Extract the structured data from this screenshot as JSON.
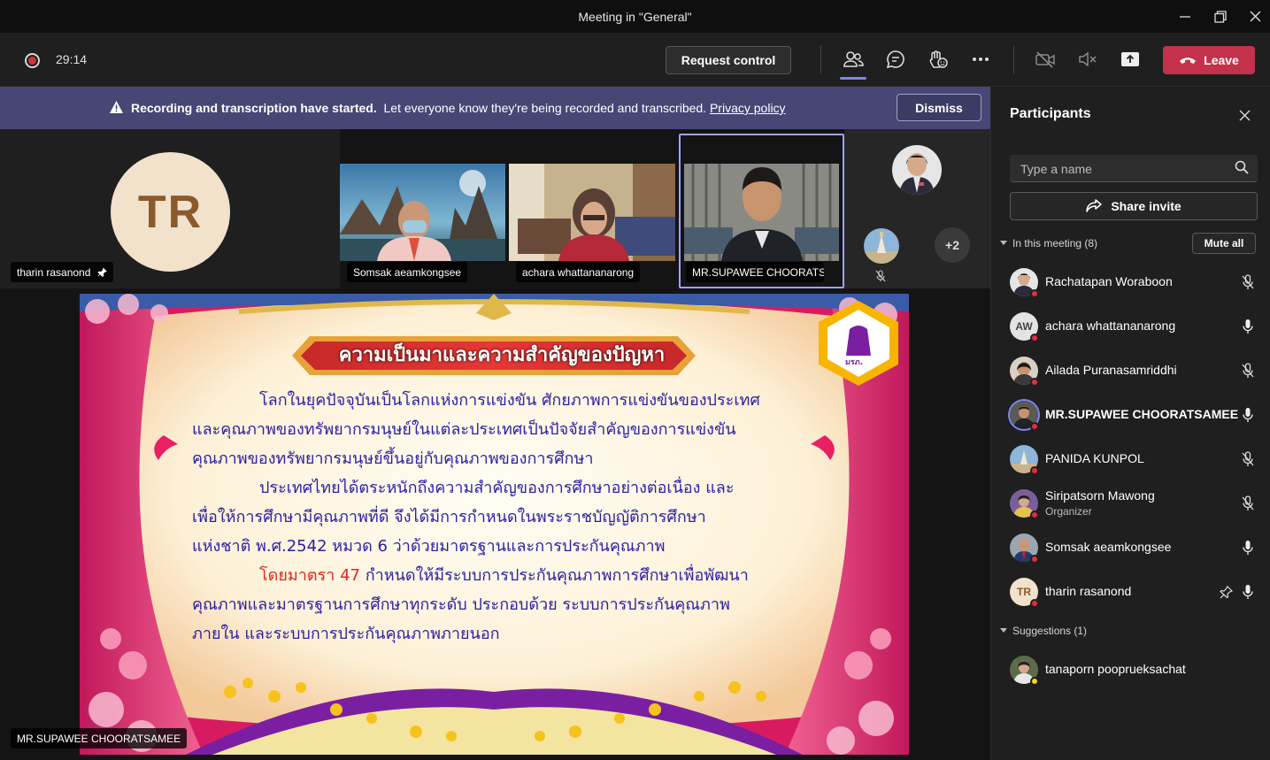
{
  "window": {
    "title": "Meeting in \"General\""
  },
  "toolbar": {
    "timer": "29:14",
    "request_control": "Request control",
    "leave": "Leave"
  },
  "banner": {
    "bold_text": "Recording and transcription have started.",
    "text": "Let everyone know they're being recorded and transcribed.",
    "link": "Privacy policy",
    "dismiss": "Dismiss"
  },
  "stage": {
    "tiles": [
      {
        "name": "tharin rasanond",
        "initials": "TR",
        "pinned": true
      },
      {
        "name": "Somsak aeamkongsee"
      },
      {
        "name": "achara whattananarong"
      },
      {
        "name": "MR.SUPAWEE CHOORATS..."
      }
    ],
    "overflow_count": "+2",
    "presenter_name": "MR.SUPAWEE CHOORATSAMEE"
  },
  "slide": {
    "title": "ความเป็นมาและความสำคัญของปัญหา",
    "lines": [
      "โลกในยุคปัจจุบันเป็นโลกแห่งการแข่งขัน ศักยภาพการแข่งขันของประเทศ",
      "และคุณภาพของทรัพยากรมนุษย์ในแต่ละประเทศเป็นปัจจัยสำคัญของการแข่งขัน",
      "คุณภาพของทรัพยากรมนุษย์ขึ้นอยู่กับคุณภาพของการศึกษา",
      "ประเทศไทยได้ตระหนักถึงความสำคัญของการศึกษาอย่างต่อเนื่อง และ",
      "เพื่อให้การศึกษามีคุณภาพที่ดี จึงได้มีการกำหนดในพระราชบัญญัติการศึกษา",
      "แห่งชาติ พ.ศ.2542 หมวด 6 ว่าด้วยมาตรฐานและการประกันคุณภาพ",
      "โดยมาตรา 47",
      "กำหนดให้มีระบบการประกันคุณภาพการศึกษาเพื่อพัฒนา",
      "คุณภาพและมาตรฐานการศึกษาทุกระดับ ประกอบด้วย ระบบการประกันคุณภาพ",
      "ภายใน และระบบการประกันคุณภาพภายนอก"
    ],
    "logo_text": "มรภ."
  },
  "panel": {
    "title": "Participants",
    "search_placeholder": "Type a name",
    "share_invite": "Share invite",
    "in_meeting_label": "In this meeting (8)",
    "mute_all": "Mute all",
    "suggestions_label": "Suggestions (1)",
    "participants": [
      {
        "name": "Rachatapan Woraboon",
        "mic": "muted"
      },
      {
        "name": "achara whattananarong",
        "initials": "AW",
        "mic": "on"
      },
      {
        "name": "Ailada Puranasamriddhi",
        "mic": "muted"
      },
      {
        "name": "MR.SUPAWEE CHOORATSAMEE",
        "mic": "on",
        "speaking": true
      },
      {
        "name": "PANIDA KUNPOL",
        "mic": "muted"
      },
      {
        "name": "Siripatsorn Mawong",
        "role": "Organizer",
        "mic": "muted"
      },
      {
        "name": "Somsak aeamkongsee",
        "mic": "on"
      },
      {
        "name": "tharin rasanond",
        "initials": "TR",
        "mic": "on",
        "pinned": true
      }
    ],
    "suggestions": [
      {
        "name": "tanaporn pooprueksachat"
      }
    ]
  },
  "colors": {
    "accent": "#7f85f5",
    "leave": "#c4314b",
    "banner": "#464775",
    "status_busy": "#e0303f",
    "slide_text": "#2b1fa3",
    "slide_highlight": "#e0261e"
  }
}
